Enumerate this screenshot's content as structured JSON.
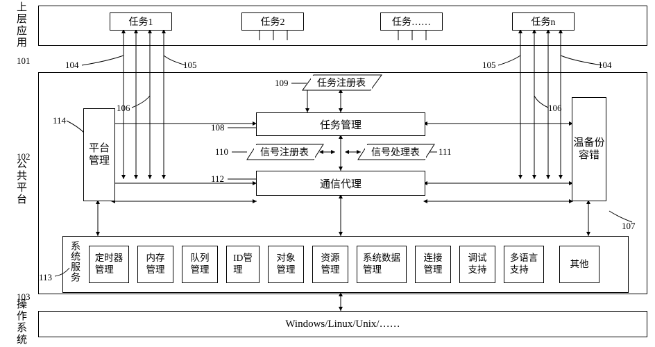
{
  "sections": {
    "upper_app": "上层应用",
    "public_platform": "公共平台",
    "os": "操作系统"
  },
  "tasks": {
    "t1": "任务1",
    "t2": "任务2",
    "tdots": "任务……",
    "tn": "任务n"
  },
  "core": {
    "platform_mgmt": "平台\n管理",
    "task_mgmt": "任务管理",
    "task_register": "任务注册表",
    "signal_register": "信号注册表",
    "signal_handler": "信号处理表",
    "comm_proxy": "通信代理",
    "warm_backup": "温备份\n容错",
    "system_services": "系统服务"
  },
  "services": {
    "timer": "定时器\n管理",
    "memory": "内存\n管理",
    "queue": "队列\n管理",
    "id": "ID管\n理",
    "object": "对象\n管理",
    "resource": "资源\n管理",
    "sysdata": "系统数据\n管理",
    "connection": "连接\n管理",
    "debug": "调试\n支持",
    "multilang": "多语言\n支持",
    "other": "其他"
  },
  "os_line": "Windows/Linux/Unix/……",
  "nums": {
    "n101": "101",
    "n102": "102",
    "n103": "103",
    "n104a": "104",
    "n104b": "104",
    "n105a": "105",
    "n105b": "105",
    "n106a": "106",
    "n106b": "106",
    "n107": "107",
    "n108": "108",
    "n109": "109",
    "n110": "110",
    "n111": "111",
    "n112": "112",
    "n113": "113",
    "n114": "114"
  }
}
